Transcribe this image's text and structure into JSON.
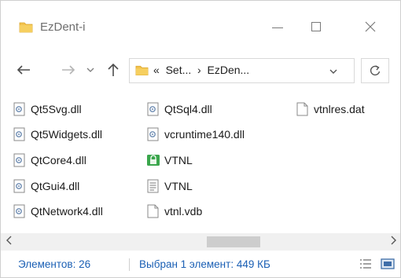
{
  "window": {
    "title": "EzDent-i",
    "controls": {
      "minimize": "minimize",
      "maximize": "maximize",
      "close": "close"
    }
  },
  "nav": {
    "address_prefix": "«",
    "breadcrumb": [
      "Set...",
      "EzDen..."
    ],
    "separator": "›"
  },
  "files": [
    {
      "name": "Qt5Svg.dll",
      "icon": "dll-icon"
    },
    {
      "name": "Qt5Widgets.dll",
      "icon": "dll-icon"
    },
    {
      "name": "QtCore4.dll",
      "icon": "dll-icon"
    },
    {
      "name": "QtGui4.dll",
      "icon": "dll-icon"
    },
    {
      "name": "QtNetwork4.dll",
      "icon": "dll-icon"
    },
    {
      "name": "QtSql4.dll",
      "icon": "dll-icon"
    },
    {
      "name": "vcruntime140.dll",
      "icon": "dll-icon"
    },
    {
      "name": "VTNL",
      "icon": "vtnl-app-icon",
      "selected": true
    },
    {
      "name": "VTNL",
      "icon": "text-file-icon"
    },
    {
      "name": "vtnl.vdb",
      "icon": "blank-file-icon"
    },
    {
      "name": "vtnlres.dat",
      "icon": "blank-file-icon"
    }
  ],
  "status": {
    "count": "Элементов: 26",
    "selection": "Выбран 1 элемент: 449 КБ"
  },
  "colors": {
    "accent": "#1a5fb4",
    "selection_border": "#e64b4b",
    "folder": "#f3c24d",
    "app_icon": "#3aa64c"
  }
}
